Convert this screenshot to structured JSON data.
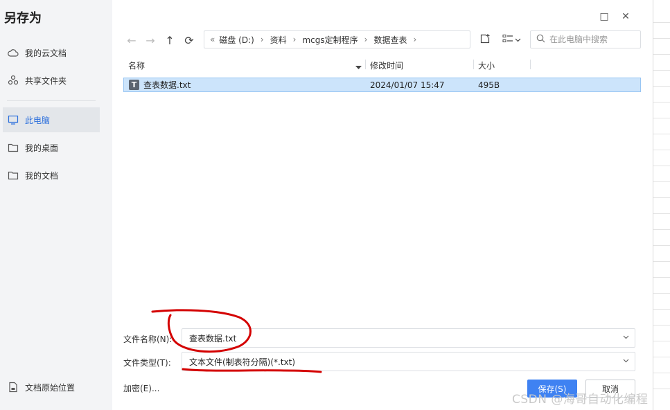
{
  "dialog": {
    "title": "另存为"
  },
  "sidebar": {
    "items": [
      {
        "label": "我的云文档",
        "icon": "cloud-icon"
      },
      {
        "label": "共享文件夹",
        "icon": "share-icon"
      },
      {
        "label": "此电脑",
        "icon": "monitor-icon",
        "active": true
      },
      {
        "label": "我的桌面",
        "icon": "folder-icon"
      },
      {
        "label": "我的文档",
        "icon": "folder-icon"
      }
    ],
    "bottom_item": {
      "label": "文档原始位置",
      "icon": "document-location-icon"
    }
  },
  "window_controls": {
    "maximize": "□",
    "close": "✕"
  },
  "nav": {
    "back": "←",
    "forward": "→",
    "up": "↑",
    "refresh": "⟳"
  },
  "breadcrumb": {
    "overflow": "«",
    "items": [
      "磁盘 (D:)",
      "资料",
      "mcgs定制程序",
      "数据查表"
    ],
    "separator": "›"
  },
  "search": {
    "placeholder": "在此电脑中搜索"
  },
  "columns": {
    "name": "名称",
    "modified": "修改时间",
    "size": "大小"
  },
  "files": [
    {
      "icon_letter": "T",
      "name": "查表数据.txt",
      "modified": "2024/01/07 15:47",
      "size": "495B",
      "selected": true
    }
  ],
  "form": {
    "filename_label": "文件名称(N):",
    "filename_value": "查表数据.txt",
    "filetype_label": "文件类型(T):",
    "filetype_value": "文本文件(制表符分隔)(*.txt)"
  },
  "footer": {
    "encrypt_label": "加密(E)...",
    "save_label": "保存(S)",
    "cancel_label": "取消"
  },
  "watermark": "CSDN @海哥自动化编程",
  "colors": {
    "accent": "#3f82f2",
    "selection": "#cce4fb",
    "annotation": "#d40000"
  }
}
